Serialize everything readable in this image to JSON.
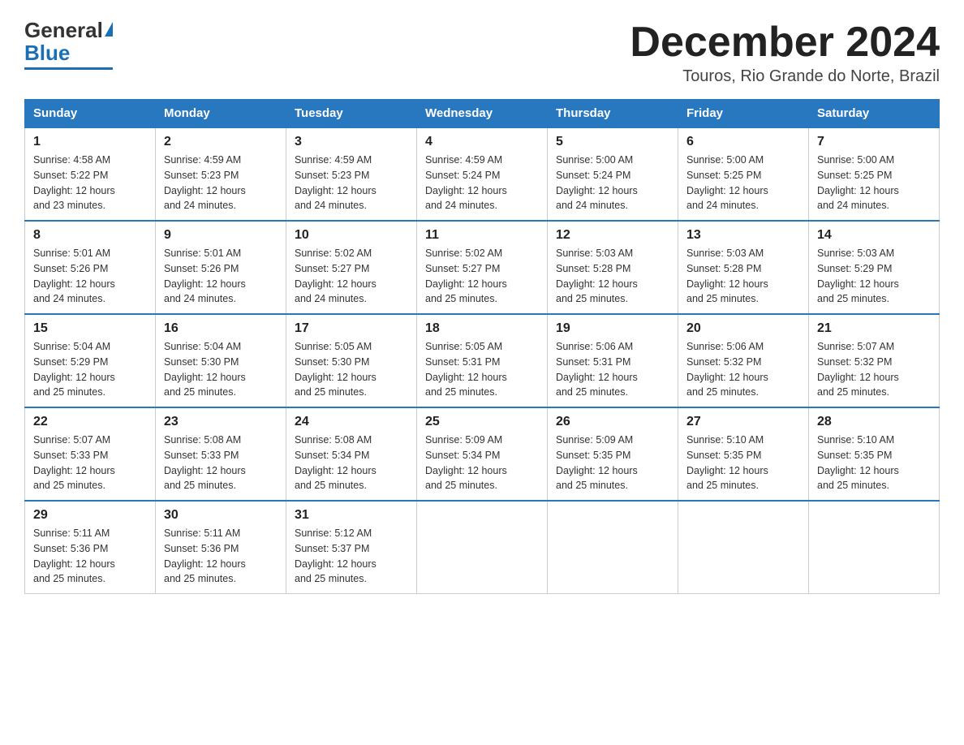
{
  "logo": {
    "general": "General",
    "blue": "Blue"
  },
  "header": {
    "month_year": "December 2024",
    "location": "Touros, Rio Grande do Norte, Brazil"
  },
  "days_of_week": [
    "Sunday",
    "Monday",
    "Tuesday",
    "Wednesday",
    "Thursday",
    "Friday",
    "Saturday"
  ],
  "weeks": [
    [
      {
        "day": "1",
        "sunrise": "4:58 AM",
        "sunset": "5:22 PM",
        "daylight": "12 hours and 23 minutes."
      },
      {
        "day": "2",
        "sunrise": "4:59 AM",
        "sunset": "5:23 PM",
        "daylight": "12 hours and 24 minutes."
      },
      {
        "day": "3",
        "sunrise": "4:59 AM",
        "sunset": "5:23 PM",
        "daylight": "12 hours and 24 minutes."
      },
      {
        "day": "4",
        "sunrise": "4:59 AM",
        "sunset": "5:24 PM",
        "daylight": "12 hours and 24 minutes."
      },
      {
        "day": "5",
        "sunrise": "5:00 AM",
        "sunset": "5:24 PM",
        "daylight": "12 hours and 24 minutes."
      },
      {
        "day": "6",
        "sunrise": "5:00 AM",
        "sunset": "5:25 PM",
        "daylight": "12 hours and 24 minutes."
      },
      {
        "day": "7",
        "sunrise": "5:00 AM",
        "sunset": "5:25 PM",
        "daylight": "12 hours and 24 minutes."
      }
    ],
    [
      {
        "day": "8",
        "sunrise": "5:01 AM",
        "sunset": "5:26 PM",
        "daylight": "12 hours and 24 minutes."
      },
      {
        "day": "9",
        "sunrise": "5:01 AM",
        "sunset": "5:26 PM",
        "daylight": "12 hours and 24 minutes."
      },
      {
        "day": "10",
        "sunrise": "5:02 AM",
        "sunset": "5:27 PM",
        "daylight": "12 hours and 24 minutes."
      },
      {
        "day": "11",
        "sunrise": "5:02 AM",
        "sunset": "5:27 PM",
        "daylight": "12 hours and 25 minutes."
      },
      {
        "day": "12",
        "sunrise": "5:03 AM",
        "sunset": "5:28 PM",
        "daylight": "12 hours and 25 minutes."
      },
      {
        "day": "13",
        "sunrise": "5:03 AM",
        "sunset": "5:28 PM",
        "daylight": "12 hours and 25 minutes."
      },
      {
        "day": "14",
        "sunrise": "5:03 AM",
        "sunset": "5:29 PM",
        "daylight": "12 hours and 25 minutes."
      }
    ],
    [
      {
        "day": "15",
        "sunrise": "5:04 AM",
        "sunset": "5:29 PM",
        "daylight": "12 hours and 25 minutes."
      },
      {
        "day": "16",
        "sunrise": "5:04 AM",
        "sunset": "5:30 PM",
        "daylight": "12 hours and 25 minutes."
      },
      {
        "day": "17",
        "sunrise": "5:05 AM",
        "sunset": "5:30 PM",
        "daylight": "12 hours and 25 minutes."
      },
      {
        "day": "18",
        "sunrise": "5:05 AM",
        "sunset": "5:31 PM",
        "daylight": "12 hours and 25 minutes."
      },
      {
        "day": "19",
        "sunrise": "5:06 AM",
        "sunset": "5:31 PM",
        "daylight": "12 hours and 25 minutes."
      },
      {
        "day": "20",
        "sunrise": "5:06 AM",
        "sunset": "5:32 PM",
        "daylight": "12 hours and 25 minutes."
      },
      {
        "day": "21",
        "sunrise": "5:07 AM",
        "sunset": "5:32 PM",
        "daylight": "12 hours and 25 minutes."
      }
    ],
    [
      {
        "day": "22",
        "sunrise": "5:07 AM",
        "sunset": "5:33 PM",
        "daylight": "12 hours and 25 minutes."
      },
      {
        "day": "23",
        "sunrise": "5:08 AM",
        "sunset": "5:33 PM",
        "daylight": "12 hours and 25 minutes."
      },
      {
        "day": "24",
        "sunrise": "5:08 AM",
        "sunset": "5:34 PM",
        "daylight": "12 hours and 25 minutes."
      },
      {
        "day": "25",
        "sunrise": "5:09 AM",
        "sunset": "5:34 PM",
        "daylight": "12 hours and 25 minutes."
      },
      {
        "day": "26",
        "sunrise": "5:09 AM",
        "sunset": "5:35 PM",
        "daylight": "12 hours and 25 minutes."
      },
      {
        "day": "27",
        "sunrise": "5:10 AM",
        "sunset": "5:35 PM",
        "daylight": "12 hours and 25 minutes."
      },
      {
        "day": "28",
        "sunrise": "5:10 AM",
        "sunset": "5:35 PM",
        "daylight": "12 hours and 25 minutes."
      }
    ],
    [
      {
        "day": "29",
        "sunrise": "5:11 AM",
        "sunset": "5:36 PM",
        "daylight": "12 hours and 25 minutes."
      },
      {
        "day": "30",
        "sunrise": "5:11 AM",
        "sunset": "5:36 PM",
        "daylight": "12 hours and 25 minutes."
      },
      {
        "day": "31",
        "sunrise": "5:12 AM",
        "sunset": "5:37 PM",
        "daylight": "12 hours and 25 minutes."
      },
      null,
      null,
      null,
      null
    ]
  ],
  "labels": {
    "sunrise": "Sunrise:",
    "sunset": "Sunset:",
    "daylight": "Daylight: 12 hours"
  }
}
